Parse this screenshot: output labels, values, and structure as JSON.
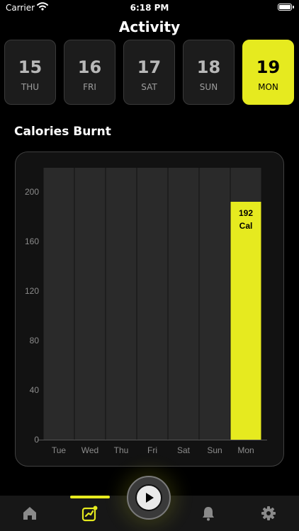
{
  "status_bar": {
    "carrier": "Carrier",
    "time": "6:18 PM"
  },
  "page_title": "Activity",
  "days": [
    {
      "num": "15",
      "weekday": "THU",
      "selected": false
    },
    {
      "num": "16",
      "weekday": "FRI",
      "selected": false
    },
    {
      "num": "17",
      "weekday": "SAT",
      "selected": false
    },
    {
      "num": "18",
      "weekday": "SUN",
      "selected": false
    },
    {
      "num": "19",
      "weekday": "MON",
      "selected": true
    }
  ],
  "section_title": "Calories Burnt",
  "chart_data": {
    "type": "bar",
    "categories": [
      "Tue",
      "Wed",
      "Thu",
      "Fri",
      "Sat",
      "Sun",
      "Mon"
    ],
    "values": [
      0,
      0,
      0,
      0,
      0,
      0,
      192
    ],
    "data_labels": [
      "",
      "",
      "",
      "",
      "",
      "",
      "192\nCal"
    ],
    "ylim": [
      0,
      200
    ],
    "yticks": [
      0,
      40,
      80,
      120,
      160,
      200
    ],
    "highlight_color": "#e6ea1f",
    "track_color": "#2a2a2a",
    "grid": false,
    "legend": "none"
  },
  "tabs": [
    {
      "icon": "home-icon",
      "selected": false
    },
    {
      "icon": "activity-icon",
      "selected": true
    },
    {
      "icon": "play-icon",
      "selected": false
    },
    {
      "icon": "bell-icon",
      "selected": false
    },
    {
      "icon": "gear-icon",
      "selected": false
    }
  ],
  "colors": {
    "accent": "#e6ea1f",
    "background": "#000000",
    "card": "#121212"
  }
}
